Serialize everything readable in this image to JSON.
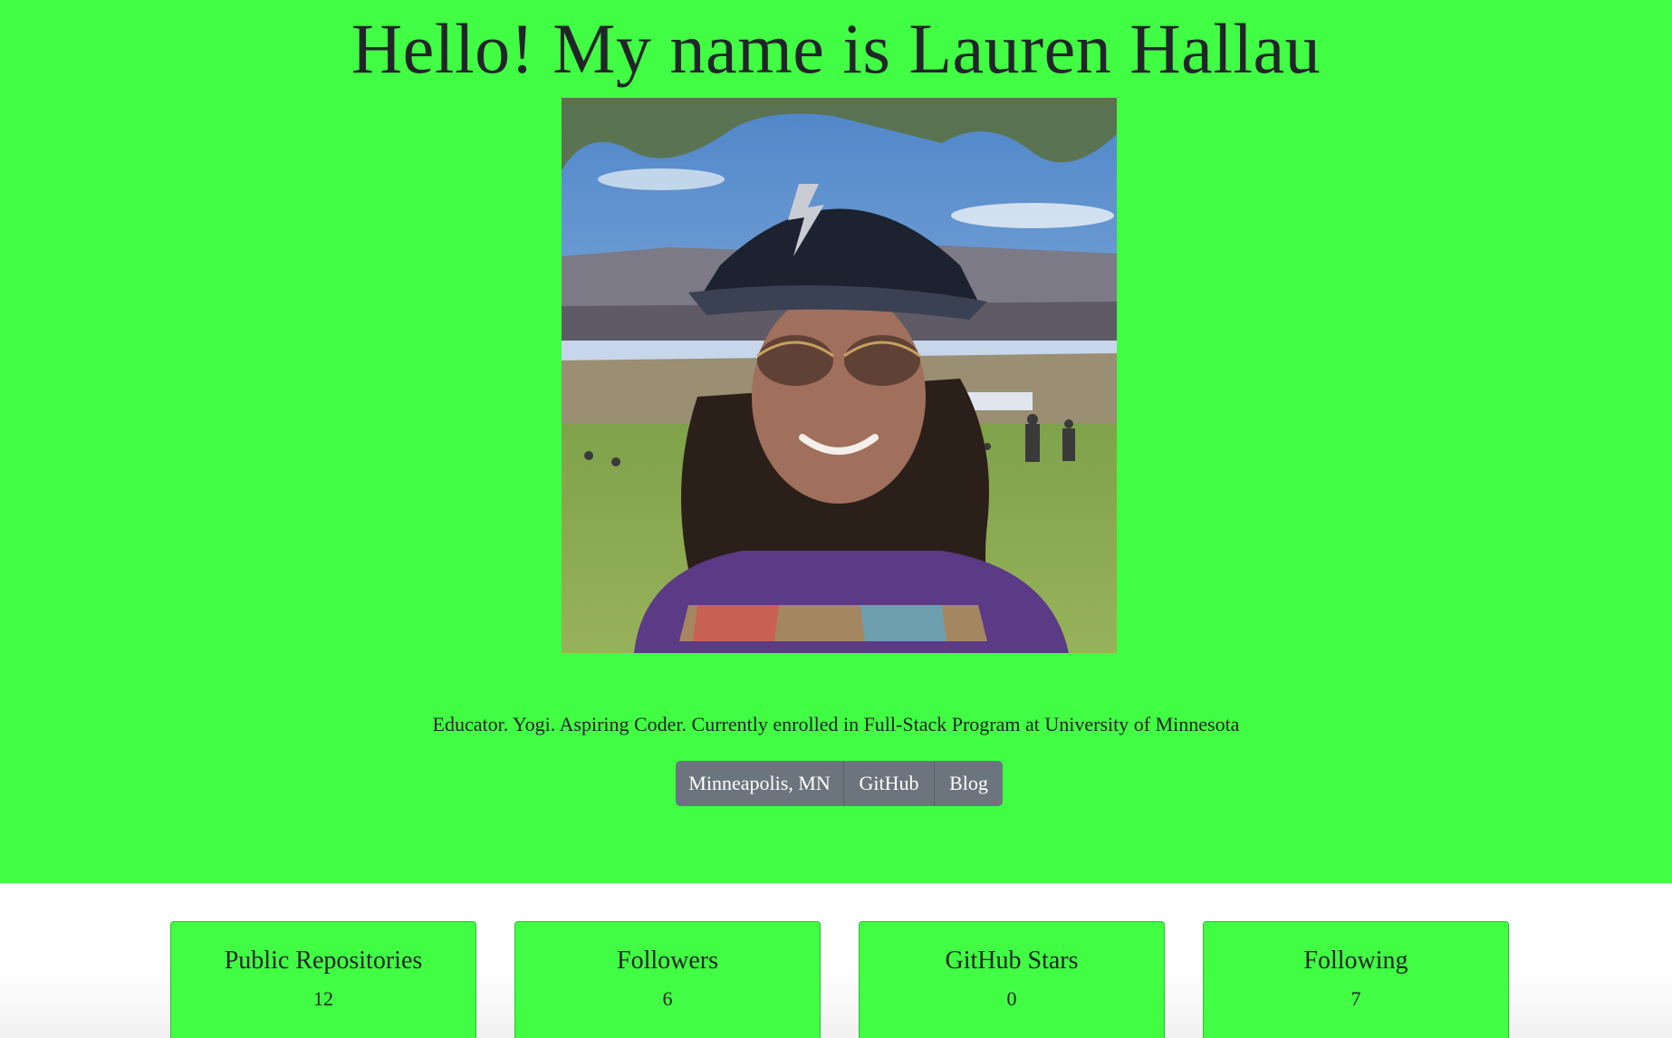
{
  "header": {
    "title": "Hello! My name is Lauren Hallau"
  },
  "profile": {
    "bio": "Educator. Yogi. Aspiring Coder. Currently enrolled in Full-Stack Program at University of Minnesota",
    "links": {
      "location": "Minneapolis, MN",
      "github": "GitHub",
      "blog": "Blog"
    }
  },
  "stats": {
    "public_repositories": {
      "label": "Public Repositories",
      "value": "12"
    },
    "followers": {
      "label": "Followers",
      "value": "6"
    },
    "github_stars": {
      "label": "GitHub Stars",
      "value": "0"
    },
    "following": {
      "label": "Following",
      "value": "7"
    }
  },
  "colors": {
    "accent": "#41fd44",
    "button": "#6c757d"
  }
}
